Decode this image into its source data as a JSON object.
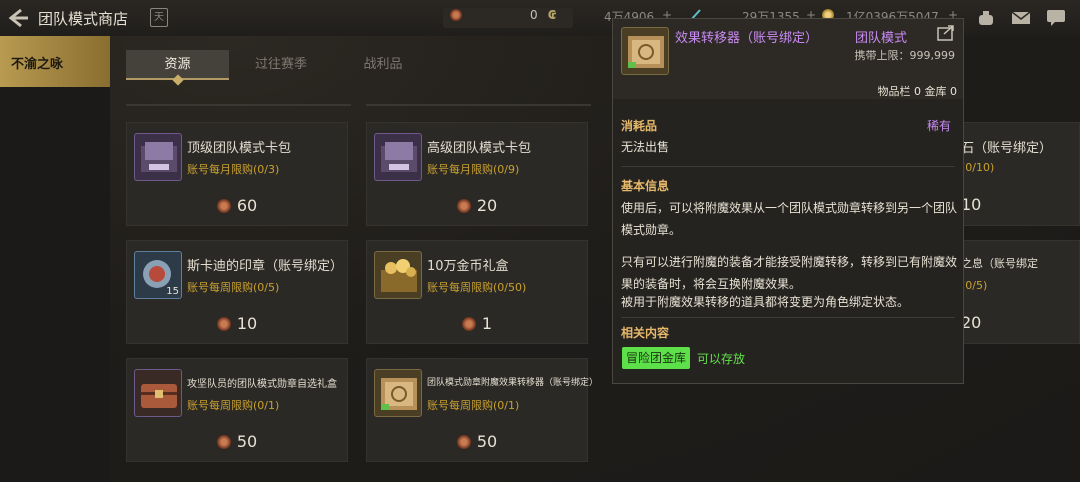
{
  "header": {
    "title": "团队模式商店",
    "calendar_icon_char": "天",
    "currency_1_value": "0",
    "currency_2_value": "4万4906",
    "currency_3_value": "29万1355",
    "currency_4_value": "1亿0396万5047",
    "plus": "+"
  },
  "sidebar": {
    "items": [
      {
        "label": "不渝之咏"
      }
    ]
  },
  "tabs": [
    {
      "label": "资源",
      "active": true
    },
    {
      "label": "过往赛季",
      "active": false
    },
    {
      "label": "战利品",
      "active": false
    }
  ],
  "cards": [
    {
      "name": "顶级团队模式卡包",
      "limit": "账号每月限购(0/3)",
      "price": "60"
    },
    {
      "name": "高级团队模式卡包",
      "limit": "账号每月限购(0/9)",
      "price": "20"
    },
    {
      "name": "斯卡迪的印章（账号绑定）",
      "limit": "账号每周限购(0/5)",
      "price": "10",
      "count": "15"
    },
    {
      "name": "10万金币礼盒",
      "limit": "账号每周限购(0/50)",
      "price": "1"
    },
    {
      "name": "攻坚队员的团队模式勋章自选礼盒",
      "limit": "账号每周限购(0/1)",
      "price": "50"
    },
    {
      "name": "团队模式勋章附魔效果转移器（账号绑定）",
      "limit": "账号每周限购(0/1)",
      "price": "50"
    }
  ],
  "partial_cards": [
    {
      "name": "石（账号绑定）",
      "limit": "(0/10)",
      "price": "10"
    },
    {
      "name": "之息（账号绑定",
      "limit": "(0/5)",
      "price": "20"
    }
  ],
  "tooltip": {
    "name": "效果转移器（账号绑定）",
    "mode": "团队模式",
    "carry_limit": "携带上限：999,999",
    "inventory": "物品栏 0 金库 0",
    "category": "消耗品",
    "rarity": "稀有",
    "tradability": "无法出售",
    "basic_info_title": "基本信息",
    "basic_info_1": "使用后，可以将附魔效果从一个团队模式勋章转移到另一个团队模式勋章。",
    "basic_info_2": "只有可以进行附魔的装备才能接受附魔转移，转移到已有附魔效果的装备时，将会互换附魔效果。",
    "basic_info_3": "被用于附魔效果转移的道具都将变更为角色绑定状态。",
    "related_title": "相关内容",
    "badge": "冒险团金库",
    "badge_desc": "可以存放"
  },
  "colors": {
    "rare_purple": "#c98bf2",
    "limit_gold": "#c9a030",
    "section_orange": "#e6b86a",
    "badge_green": "#5ee04a"
  }
}
